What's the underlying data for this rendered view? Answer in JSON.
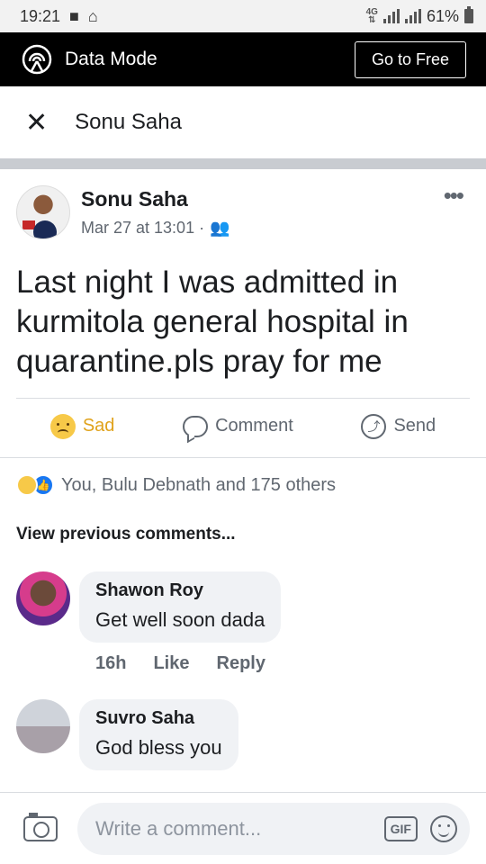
{
  "status_bar": {
    "time": "19:21",
    "network": "4G",
    "battery": "61%"
  },
  "data_mode": {
    "label": "Data Mode",
    "button": "Go to Free"
  },
  "header": {
    "title": "Sonu Saha"
  },
  "post": {
    "author": "Sonu Saha",
    "time": "Mar 27 at 13:01 ·",
    "text": "Last night I was admitted in kurmitola general hospital in quarantine.pls pray for me"
  },
  "actions": {
    "sad": "Sad",
    "comment": "Comment",
    "send": "Send"
  },
  "reactions": {
    "summary": "You, Bulu Debnath and 175 others"
  },
  "view_previous": "View previous comments...",
  "comments": [
    {
      "name": "Shawon Roy",
      "text": "Get well soon dada",
      "time": "16h",
      "like": "Like",
      "reply": "Reply"
    },
    {
      "name": "Suvro Saha",
      "text": "God bless you"
    }
  ],
  "composer": {
    "placeholder": "Write a comment...",
    "gif": "GIF"
  },
  "colors": {
    "accent": "#1877f2",
    "sad": "#e0a21b"
  }
}
